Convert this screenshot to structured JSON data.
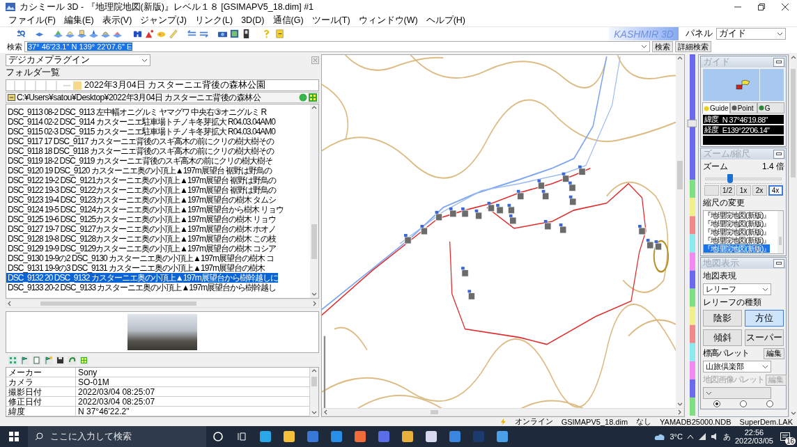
{
  "window": {
    "title": "カシミール 3D - 『地理院地図(新版)』レベル１８ [GSIMAPV5_18.dim] #1"
  },
  "menu": [
    "ファイル(F)",
    "編集(E)",
    "表示(V)",
    "ジャンプ(J)",
    "リンク(L)",
    "3D(D)",
    "通信(G)",
    "ツール(T)",
    "ウィンドウ(W)",
    "ヘルプ(H)"
  ],
  "toolbar": {
    "logo": "KASHMIR 3D",
    "panel_label": "パネル",
    "panel_value": "ガイド"
  },
  "search": {
    "label": "検索",
    "value": "37° 46'23.1\" N 139° 22'07.6\" E",
    "buttons": [
      "検索",
      "詳細検索"
    ]
  },
  "left_panel": {
    "plugin": "デジカメプラグイン",
    "folder_label": "フォルダ一覧",
    "folder": "2022年3月04日 カスターニエ背後の森林公園",
    "path": "C:¥Users¥satou¥Desktop¥2022年3月04日 カスターニエ背後の森林公",
    "files": [
      {
        "name": "DSC_9113 08-2 DSC_9113 左中幅オニグルミ ヤマグワ 中央右③オニグルミ R",
        "selected": false
      },
      {
        "name": "DSC_9114 02-2 DSC_9114 カスターニエ駐車場トチノキ冬芽拡大 R04.03.04AM0",
        "selected": false
      },
      {
        "name": "DSC_9115 02-3 DSC_9115 カスターニエ駐車場トチノキ冬芽拡大 R04.03.04AM0",
        "selected": false
      },
      {
        "name": "DSC_9117 17 DSC_9117 カスターニエ背後のスギ高木の前にクリの樹大樹その",
        "selected": false
      },
      {
        "name": "DSC_9118 18 DSC_9118 カスターニエ背後のスギ高木の前にクリの樹大樹その",
        "selected": false
      },
      {
        "name": "DSC_9119 18-2 DSC_9119 カスターニエ背後のスギ高木の前にクリの樹大樹そ",
        "selected": false
      },
      {
        "name": "DSC_9120 19 DSC_9120 カスターニエ奥の小頂上▲197m展望台 裾野は野鳥の",
        "selected": false
      },
      {
        "name": "DSC_9122 19-2 DSC_9121カスターニエ奥の小頂上▲197m展望台 裾野は野鳥の",
        "selected": false
      },
      {
        "name": "DSC_9122 19-3 DSC_9122カスターニエ奥の小頂上▲197m展望台 裾野は野鳥の",
        "selected": false
      },
      {
        "name": "DSC_9123 19-4 DSC_9123カスターニエ奥の小頂上▲197m展望台の樹木 タムシ",
        "selected": false
      },
      {
        "name": "DSC_9124 19-5 DSC_9124カスターニエ奥の小頂上▲197m展望台から樹木 リョウ",
        "selected": false
      },
      {
        "name": "DSC_9125 19-6 DSC_9125カスターニエ奥の小頂上▲197m展望台の樹木 リョウ",
        "selected": false
      },
      {
        "name": "DSC_9127 19-7 DSC_9127カスターニエ奥の小頂上▲197m展望台の樹木 ホオノ",
        "selected": false
      },
      {
        "name": "DSC_9128 19-8 DSC_9128カスターニエ奥の小頂上▲197m展望台の樹木 この枝",
        "selected": false
      },
      {
        "name": "DSC_9129 19-9 DSC_9129カスターニエ奥の小頂上▲197m展望台の樹木 コシア",
        "selected": false
      },
      {
        "name": "DSC_9130 19-9の2 DSC_9130 カスターニエ奥の小頂上▲197m展望台の樹木 コ",
        "selected": false
      },
      {
        "name": "DSC_9131 19-9の3 DSC_9131 カスターニエ奥の小頂上▲197m展望台の樹木",
        "selected": false
      },
      {
        "name": "DSC_9132 20 DSC_9132 カスターニエ奥の小頂上▲197m展望台から樹幹越しに",
        "selected": true
      },
      {
        "name": "DSC_9133 20-2 DSC_9133 カスターニエ奥の小頂上▲197m展望台から樹幹越し",
        "selected": false
      }
    ],
    "properties": [
      {
        "name": "メーカー",
        "value": "Sony"
      },
      {
        "name": "カメラ",
        "value": "SO-01M"
      },
      {
        "name": "撮影日付",
        "value": "2022/03/04 08:25:07"
      },
      {
        "name": "修正日付",
        "value": "2022/03/04 08:25:07"
      },
      {
        "name": "緯度",
        "value": "N 37°46'22.2\""
      }
    ]
  },
  "right_panel": {
    "guide": {
      "title": "ガイド",
      "tabs": [
        {
          "label": "Guide",
          "selected": true
        },
        {
          "label": "Point",
          "selected": false
        },
        {
          "label": "G",
          "selected": false
        }
      ],
      "coordinates": [
        {
          "label": "緯度",
          "value": "N 37°46'19.88\""
        },
        {
          "label": "経度",
          "value": "E139°22'06.14\""
        }
      ]
    },
    "zoom": {
      "title": "ズーム/縮尺",
      "label": "ズーム",
      "value": "1.4 倍",
      "level": 0.33,
      "buttons": [
        {
          "label": "1/2",
          "selected": false
        },
        {
          "label": "1x",
          "selected": false
        },
        {
          "label": "2x",
          "selected": false
        },
        {
          "label": "4x",
          "selected": true
        }
      ],
      "scale_label": "縮尺の変更",
      "scales": [
        {
          "label": "『地理院地図(新版)』",
          "selected": false
        },
        {
          "label": "『地理院地図(新版)』",
          "selected": false
        },
        {
          "label": "『地理院地図(新版)』",
          "selected": false
        },
        {
          "label": "『地理院地図(新版)』",
          "selected": false
        },
        {
          "label": "『地理院地図(新版)』",
          "selected": true
        }
      ]
    },
    "map_display": {
      "title": "地図表示",
      "style_label": "地図表現",
      "style": "レリーフ",
      "relief_label": "レリーフの種類",
      "relief_buttons": [
        {
          "label": "陰影",
          "selected": false
        },
        {
          "label": "方位",
          "selected": true
        },
        {
          "label": "傾斜",
          "selected": false
        },
        {
          "label": "スーパー",
          "selected": false
        }
      ],
      "palettes": [
        {
          "label": "標高パレット",
          "button": "編集",
          "value": "山旅倶楽部",
          "disabled": false
        },
        {
          "label": "地図画像パレット",
          "button": "編集",
          "disabled": true
        }
      ],
      "radios": [
        {
          "selected": true
        },
        {
          "selected": false
        },
        {
          "selected": false
        }
      ]
    }
  },
  "status_bar": [
    "オンライン",
    "GSIMAPV5_18.dim",
    "なし",
    "YAMADB25000.NDB",
    "SuperDem.LAK"
  ],
  "taskbar": {
    "search_placeholder": "ここに入力して検索",
    "weather": "3°C",
    "ime": "あ",
    "time": "22:56",
    "date": "2022/03/05",
    "notifications": "16"
  }
}
